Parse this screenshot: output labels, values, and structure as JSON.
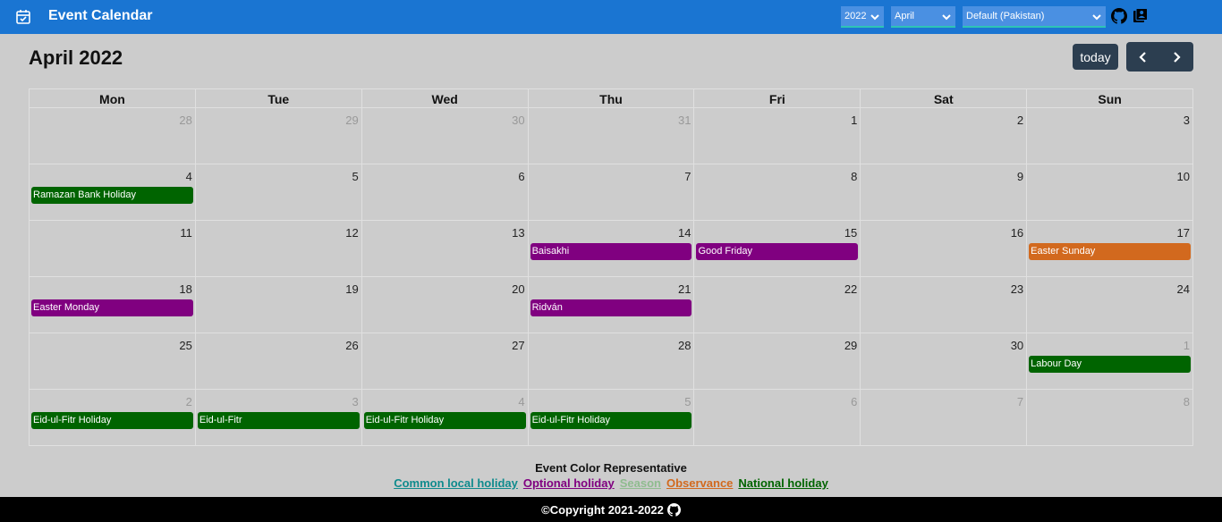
{
  "app": {
    "title": "Event Calendar"
  },
  "controls": {
    "year": "2022",
    "month": "April",
    "region": "Default (Pakistan)",
    "today_label": "today"
  },
  "calendar": {
    "title": "April 2022",
    "weekdays": [
      "Mon",
      "Tue",
      "Wed",
      "Thu",
      "Fri",
      "Sat",
      "Sun"
    ],
    "weeks": [
      [
        {
          "d": "28",
          "o": true
        },
        {
          "d": "29",
          "o": true
        },
        {
          "d": "30",
          "o": true
        },
        {
          "d": "31",
          "o": true
        },
        {
          "d": "1"
        },
        {
          "d": "2"
        },
        {
          "d": "3"
        }
      ],
      [
        {
          "d": "4",
          "ev": "Ramazan Bank Holiday",
          "c": "national"
        },
        {
          "d": "5"
        },
        {
          "d": "6"
        },
        {
          "d": "7"
        },
        {
          "d": "8"
        },
        {
          "d": "9"
        },
        {
          "d": "10"
        }
      ],
      [
        {
          "d": "11"
        },
        {
          "d": "12"
        },
        {
          "d": "13"
        },
        {
          "d": "14",
          "ev": "Baisakhi",
          "c": "optional"
        },
        {
          "d": "15",
          "ev": "Good Friday",
          "c": "optional"
        },
        {
          "d": "16"
        },
        {
          "d": "17",
          "ev": "Easter Sunday",
          "c": "observance"
        }
      ],
      [
        {
          "d": "18",
          "ev": "Easter Monday",
          "c": "optional"
        },
        {
          "d": "19"
        },
        {
          "d": "20"
        },
        {
          "d": "21",
          "ev": "Ridván",
          "c": "optional"
        },
        {
          "d": "22"
        },
        {
          "d": "23"
        },
        {
          "d": "24"
        }
      ],
      [
        {
          "d": "25"
        },
        {
          "d": "26"
        },
        {
          "d": "27"
        },
        {
          "d": "28"
        },
        {
          "d": "29"
        },
        {
          "d": "30"
        },
        {
          "d": "1",
          "o": true,
          "ev": "Labour Day",
          "c": "national"
        }
      ],
      [
        {
          "d": "2",
          "o": true,
          "ev": "Eid-ul-Fitr Holiday",
          "c": "national"
        },
        {
          "d": "3",
          "o": true,
          "ev": "Eid-ul-Fitr",
          "c": "national"
        },
        {
          "d": "4",
          "o": true,
          "ev": "Eid-ul-Fitr Holiday",
          "c": "national"
        },
        {
          "d": "5",
          "o": true,
          "ev": "Eid-ul-Fitr Holiday",
          "c": "national"
        },
        {
          "d": "6",
          "o": true
        },
        {
          "d": "7",
          "o": true
        },
        {
          "d": "8",
          "o": true
        }
      ]
    ]
  },
  "colors": {
    "national": "#006400",
    "optional": "#800080",
    "observance": "#d2691e",
    "common": "#0f8b8d",
    "season": "#8fbc8f"
  },
  "legend": {
    "title": "Event Color Representative",
    "items": [
      {
        "label": "Common local holiday",
        "key": "common"
      },
      {
        "label": "Optional holiday",
        "key": "optional"
      },
      {
        "label": "Season",
        "key": "season"
      },
      {
        "label": "Observance",
        "key": "observance"
      },
      {
        "label": "National holiday",
        "key": "national"
      }
    ]
  },
  "footer": {
    "text": "©Copyright 2021-2022"
  }
}
